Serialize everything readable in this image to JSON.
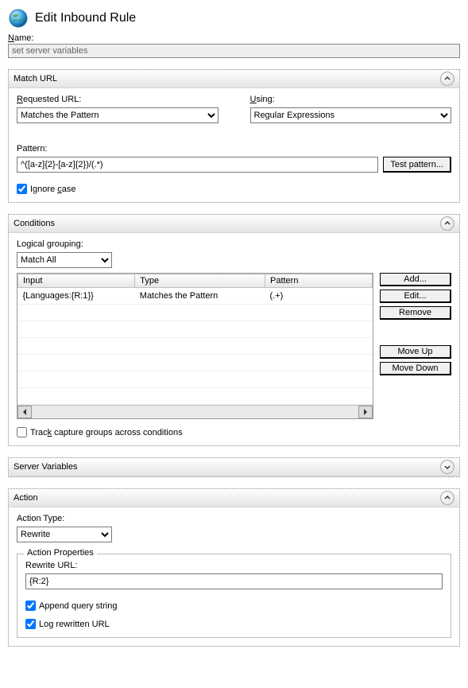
{
  "header": {
    "title": "Edit Inbound Rule"
  },
  "name": {
    "label": "Name:",
    "value": "set server variables"
  },
  "match_url": {
    "title": "Match URL",
    "requested_url_label_pre": "R",
    "requested_url_label": "equested URL:",
    "requested_url_value": "Matches the Pattern",
    "using_label_pre": "U",
    "using_label": "sing:",
    "using_value": "Regular Expressions",
    "pattern_label": "Pattern:",
    "pattern_value": "^([a-z]{2}-[a-z]{2})/(.*)",
    "test_button": "Test pattern...",
    "ignore_case_label": "Ignore ",
    "ignore_case_label_u": "c",
    "ignore_case_label_post": "ase",
    "ignore_case_checked": true
  },
  "conditions": {
    "title": "Conditions",
    "logical_grouping_label": "Logical grouping:",
    "logical_grouping_value": "Match All",
    "columns": {
      "input": "Input",
      "type": "Type",
      "pattern": "Pattern"
    },
    "rows": [
      {
        "input": "{Languages:{R:1}}",
        "type": "Matches the Pattern",
        "pattern": "(.+)"
      }
    ],
    "buttons": {
      "add": "Add...",
      "edit": "Edit...",
      "remove": "Remove",
      "move_up": "Move Up",
      "move_down": "Move Down"
    },
    "track_label": "Trac",
    "track_label_u": "k",
    "track_label_post": " capture groups across conditions",
    "track_checked": false
  },
  "server_variables": {
    "title": "Server Variables"
  },
  "action": {
    "title": "Action",
    "action_type_label": "Action Type:",
    "action_type_value": "Rewrite",
    "properties_title": "Action Properties",
    "rewrite_url_label": "Rewrite URL:",
    "rewrite_url_value": "{R:2}",
    "append_label": "Append query string",
    "append_checked": true,
    "log_label": "Log rewritten URL",
    "log_checked": true
  }
}
